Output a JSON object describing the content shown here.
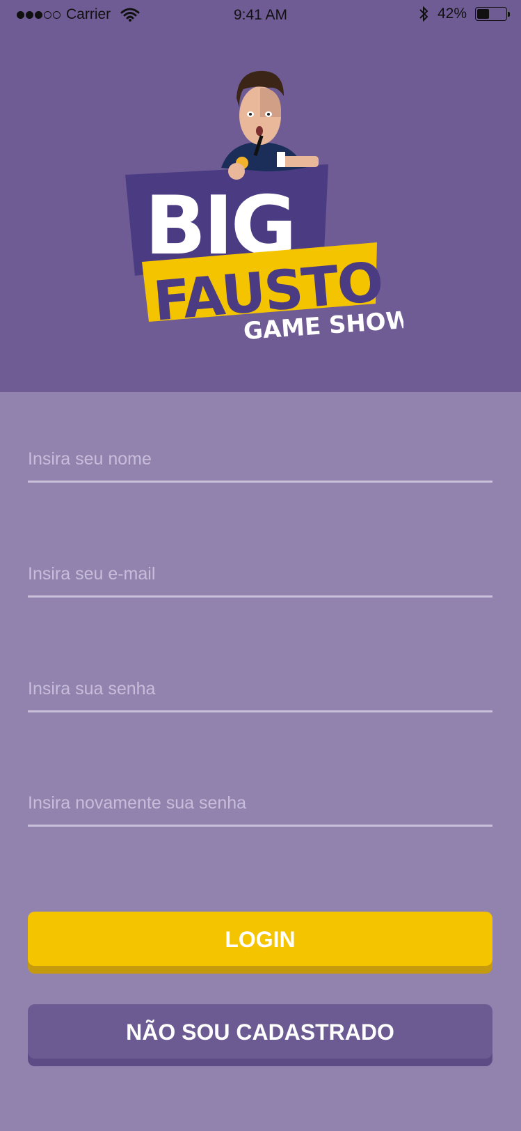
{
  "status_bar": {
    "carrier": "Carrier",
    "time": "9:41 AM",
    "battery_percent": "42%",
    "battery_level": 0.42
  },
  "logo": {
    "word1": "BIG",
    "word2": "FAUSTO",
    "word3": "GAME SHOW"
  },
  "form": {
    "name_placeholder": "Insira seu nome",
    "email_placeholder": "Insira seu e-mail",
    "password_placeholder": "Insira sua senha",
    "password_confirm_placeholder": "Insira novamente sua senha",
    "login_label": "LOGIN",
    "register_label": "NÃO SOU CADASTRADO"
  },
  "colors": {
    "header_bg": "#6f5c94",
    "form_bg": "#9283ae",
    "accent_yellow": "#f5c400",
    "logo_purple": "#4b3b82"
  }
}
